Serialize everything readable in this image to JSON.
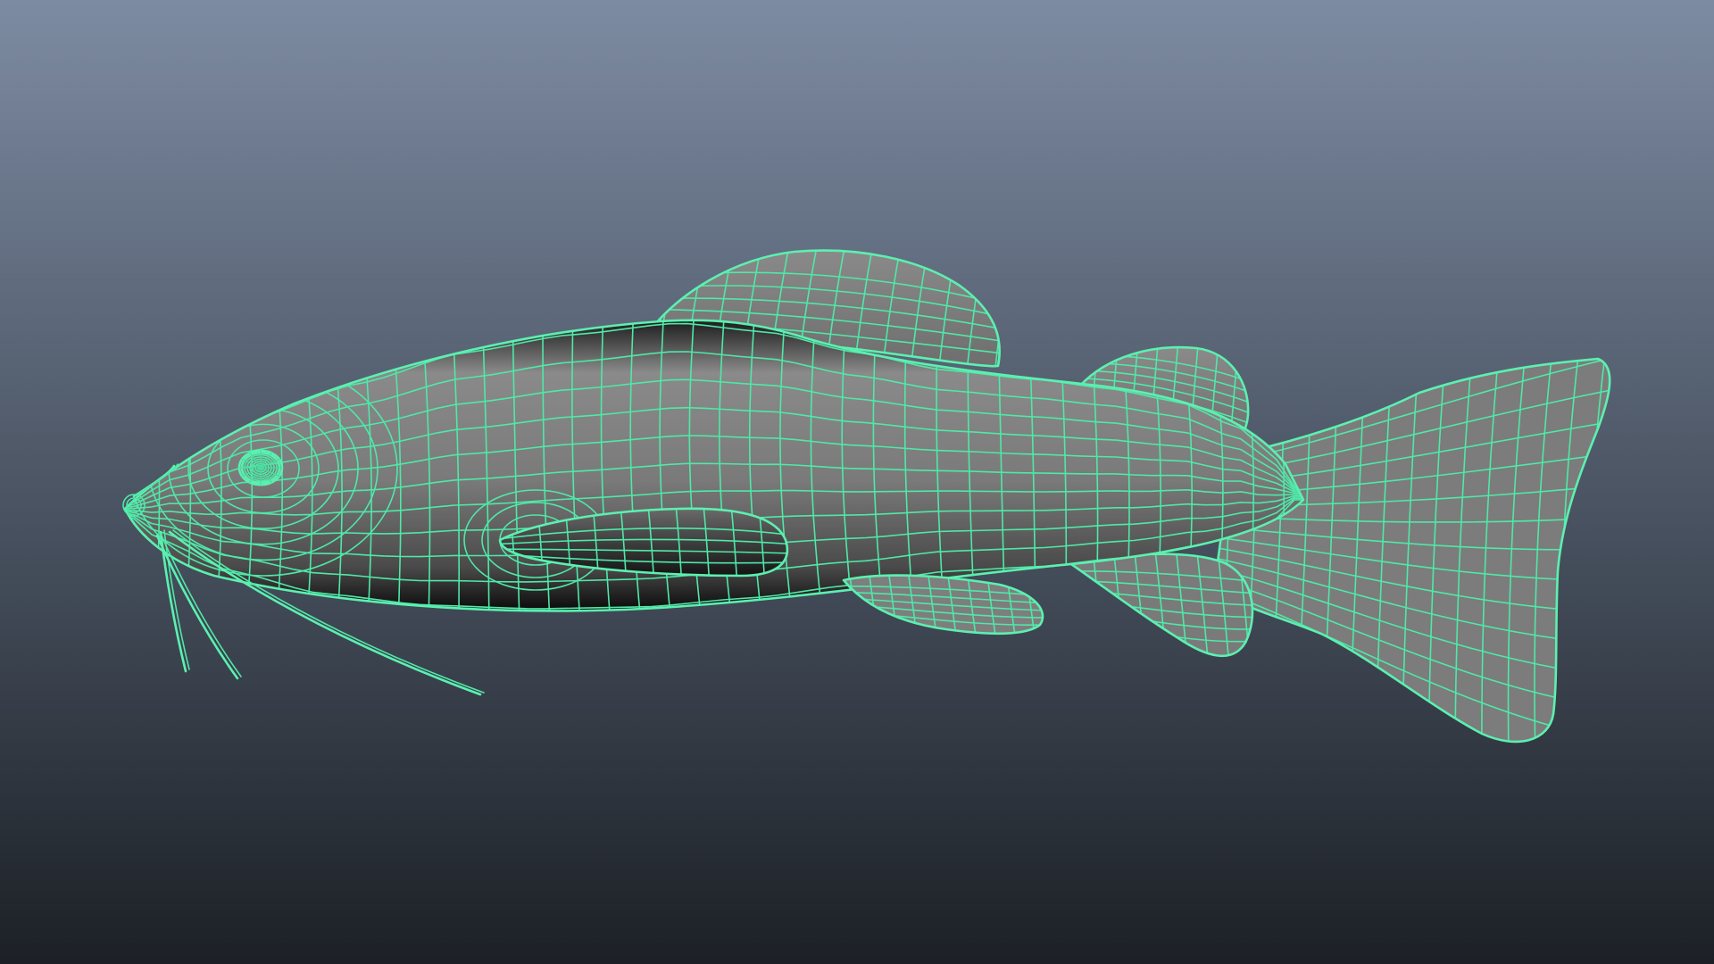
{
  "viewport": {
    "background_top": "#7d8ba2",
    "background_bottom": "#1c2026",
    "shade": "perspective"
  },
  "model": {
    "name": "catfish",
    "display_mode": "wireframe-on-shaded",
    "surface_color": "#7a7a7a",
    "surface_dark": "#0f0f0f",
    "wire_color": "#4fe8a8",
    "selected": true,
    "parts": [
      "body",
      "dorsal-fin",
      "adipose-fin",
      "caudal-fin",
      "pectoral-fin",
      "pelvic-fin",
      "anal-fin",
      "eye",
      "barbels"
    ]
  }
}
